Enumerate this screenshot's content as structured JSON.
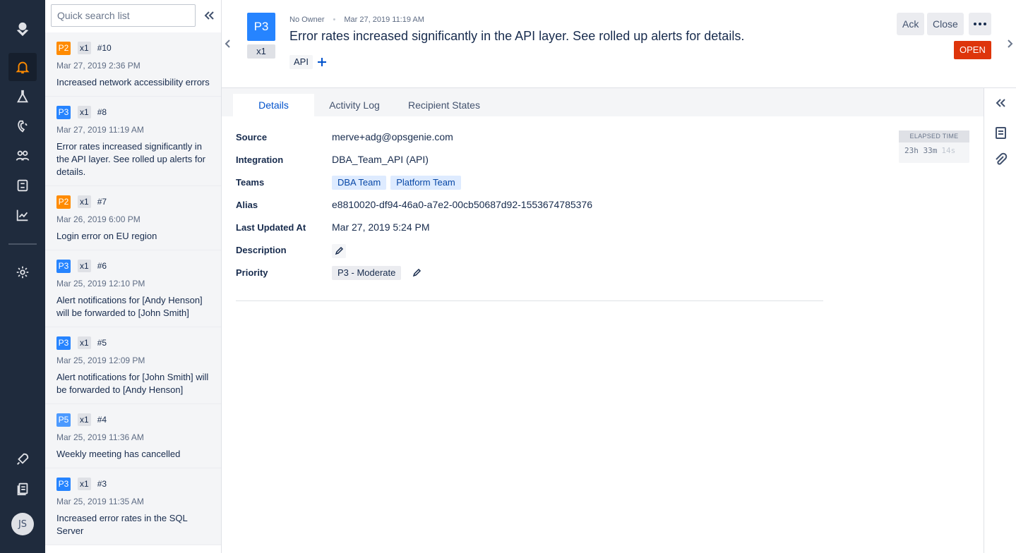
{
  "nav": {
    "items": [
      {
        "name": "logo",
        "icon": "opsgenie-logo-icon"
      },
      {
        "name": "alerts",
        "icon": "bell-icon",
        "active": true
      },
      {
        "name": "incidents",
        "icon": "flask-icon"
      },
      {
        "name": "on-call",
        "icon": "phone-icon"
      },
      {
        "name": "teams",
        "icon": "people-icon"
      },
      {
        "name": "services",
        "icon": "service-icon"
      },
      {
        "name": "analytics",
        "icon": "chart-icon"
      },
      {
        "name": "settings",
        "icon": "gear-icon"
      },
      {
        "name": "get-started",
        "icon": "rocket-icon"
      },
      {
        "name": "docs",
        "icon": "book-icon"
      }
    ],
    "avatar": "JS"
  },
  "list": {
    "search_placeholder": "Quick search list",
    "alerts": [
      {
        "priority": "P2",
        "count": "x1",
        "number": "#10",
        "date": "Mar 27, 2019 2:36 PM",
        "message": "Increased network accessibility errors"
      },
      {
        "priority": "P3",
        "count": "x1",
        "number": "#8",
        "date": "Mar 27, 2019 11:19 AM",
        "message": "Error rates increased significantly in the API layer. See rolled up alerts for details."
      },
      {
        "priority": "P2",
        "count": "x1",
        "number": "#7",
        "date": "Mar 26, 2019 6:00 PM",
        "message": "Login error on EU region"
      },
      {
        "priority": "P3",
        "count": "x1",
        "number": "#6",
        "date": "Mar 25, 2019 12:10 PM",
        "message": "Alert notifications for [Andy Henson] will be forwarded to [John Smith]"
      },
      {
        "priority": "P3",
        "count": "x1",
        "number": "#5",
        "date": "Mar 25, 2019 12:09 PM",
        "message": "Alert notifications for [John Smith] will be forwarded to [Andy Henson]"
      },
      {
        "priority": "P5",
        "count": "x1",
        "number": "#4",
        "date": "Mar 25, 2019 11:36 AM",
        "message": "Weekly meeting has cancelled"
      },
      {
        "priority": "P3",
        "count": "x1",
        "number": "#3",
        "date": "Mar 25, 2019 11:35 AM",
        "message": "Increased error rates in the SQL Server"
      }
    ]
  },
  "header": {
    "priority": "P3",
    "count": "x1",
    "owner": "No Owner",
    "date": "Mar 27, 2019 11:19 AM",
    "title": "Error rates increased significantly in the API layer. See rolled up alerts for details.",
    "tag": "API",
    "ack_label": "Ack",
    "close_label": "Close",
    "status": "OPEN"
  },
  "tabs": [
    "Details",
    "Activity Log",
    "Recipient States"
  ],
  "details": {
    "source_label": "Source",
    "source": "merve+adg@opsgenie.com",
    "integration_label": "Integration",
    "integration": "DBA_Team_API (API)",
    "teams_label": "Teams",
    "teams": [
      "DBA Team",
      "Platform Team"
    ],
    "alias_label": "Alias",
    "alias": "e8810020-df94-46a0-a7e2-00cb50687d92-1553674785376",
    "updated_label": "Last Updated At",
    "updated": "Mar 27, 2019 5:24 PM",
    "description_label": "Description",
    "priority_label": "Priority",
    "priority": "P3 - Moderate"
  },
  "elapsed": {
    "label": "ELAPSED TIME",
    "value": "23h 33m",
    "seconds": "14s"
  },
  "colors": {
    "p2": "#ff8b00",
    "p3": "#2684ff",
    "p5": "#4c9aff",
    "open": "#de350b",
    "nav_bg": "#1f2b3d",
    "accent": "#0052cc"
  }
}
